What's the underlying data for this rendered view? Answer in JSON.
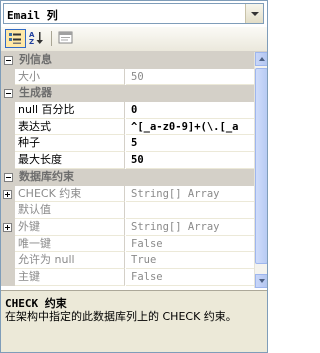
{
  "object_selector": {
    "value": "Email 列"
  },
  "toolbar": {
    "buttons": [
      {
        "name": "categorized-button",
        "icon": "categorized-icon",
        "selected": true
      },
      {
        "name": "alphabetical-button",
        "icon": "sort-az-icon",
        "selected": false
      },
      {
        "name": "property-pages-button",
        "icon": "property-pages-icon",
        "selected": false
      }
    ]
  },
  "categories": {
    "column_info": {
      "label": "列信息"
    },
    "generator": {
      "label": "生成器"
    },
    "db_constraints": {
      "label": "数据库约束"
    }
  },
  "properties": {
    "size": {
      "name": "大小",
      "value": "50"
    },
    "null_percent": {
      "name": "null 百分比",
      "value": "0"
    },
    "expression": {
      "name": "表达式",
      "value": "^[_a-z0-9]+(\\.[_a"
    },
    "seed": {
      "name": "种子",
      "value": "5"
    },
    "max_length": {
      "name": "最大长度",
      "value": "50"
    },
    "check": {
      "name": "CHECK 约束",
      "value": "String[] Array"
    },
    "default": {
      "name": "默认值",
      "value": ""
    },
    "foreign_key": {
      "name": "外键",
      "value": "String[] Array"
    },
    "unique": {
      "name": "唯一键",
      "value": "False"
    },
    "nullable": {
      "name": "允许为 null",
      "value": "True"
    },
    "primary_key": {
      "name": "主键",
      "value": "False"
    }
  },
  "description": {
    "title": "CHECK 约束",
    "text": "在架构中指定的此数据库列上的 CHECK 约束。"
  },
  "colors": {
    "category_bg": "#d4d0c8",
    "category_text": "#6d6d6d",
    "readonly_text": "#8a8a8a",
    "description_bg": "#ece9d8",
    "selected_button": "#ffe8a6"
  }
}
